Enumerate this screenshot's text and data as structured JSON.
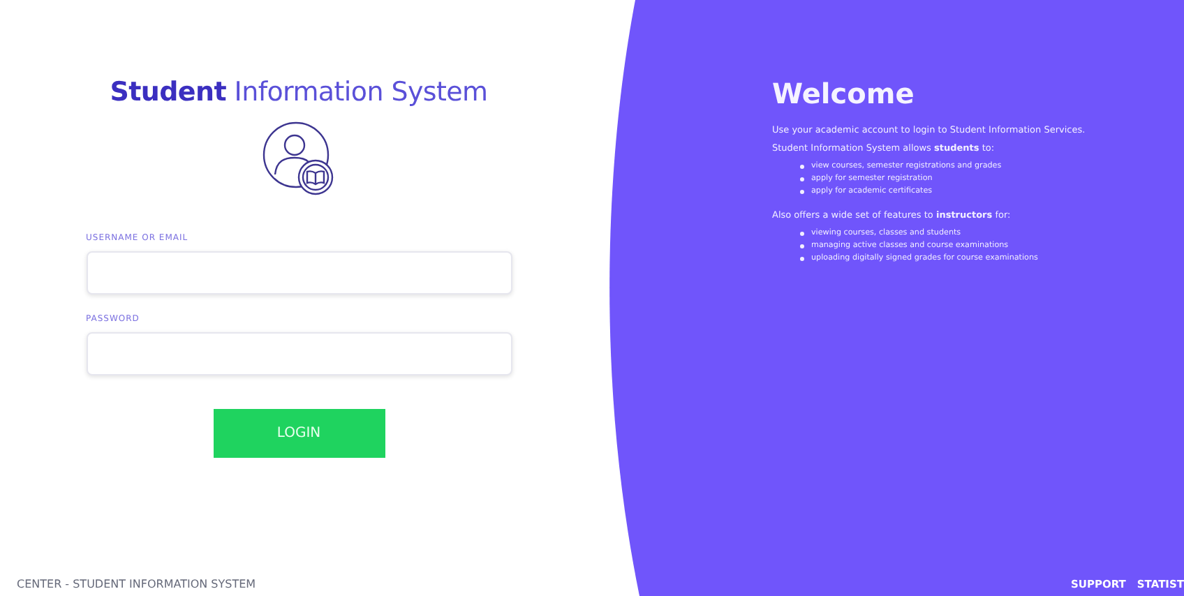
{
  "login": {
    "title_bold": "Student",
    "title_rest": "Information System",
    "fields": [
      {
        "label": "USERNAME OR EMAIL"
      },
      {
        "label": "PASSWORD"
      }
    ],
    "button": "LOGIN",
    "footer": "CENTER - STUDENT INFORMATION SYSTEM"
  },
  "welcome": {
    "title": "Welcome",
    "intro": "Use your academic account to login to Student Information Services.",
    "sections": [
      {
        "lead": "Student Information System allows **students** to:",
        "items": [
          "view courses, semester registrations and grades",
          "apply for semester registration",
          "apply for academic certificates"
        ]
      },
      {
        "lead": "Also offers a wide set of features to **instructors** for:",
        "items": [
          "viewing courses, classes and students",
          "managing active classes and course examinations",
          "uploading digitally signed grades for course examinations"
        ]
      }
    ],
    "links": [
      "SUPPORT",
      "STATIST"
    ]
  }
}
